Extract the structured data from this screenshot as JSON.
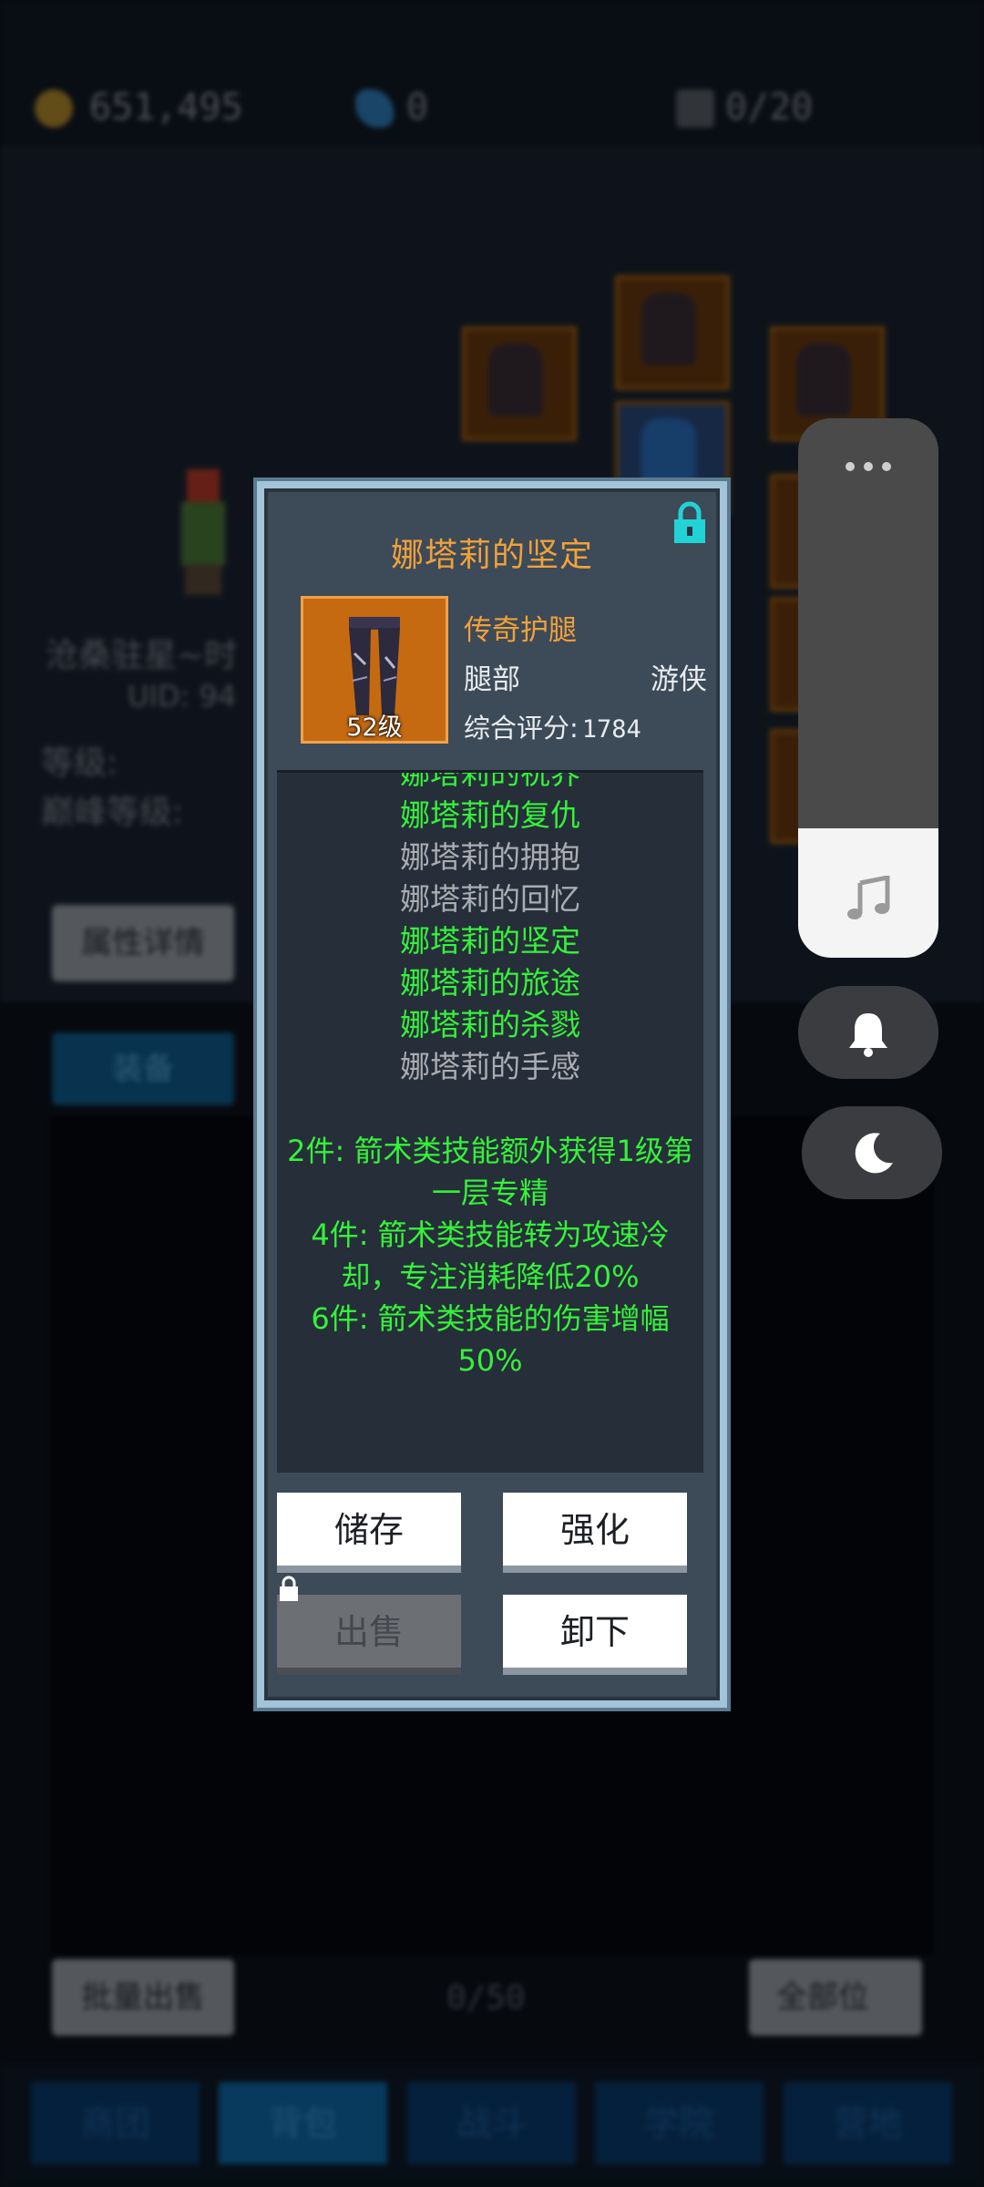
{
  "resources": {
    "gold": "651,495",
    "gems": "0",
    "capacity": "0/20"
  },
  "background": {
    "player_name": "沧桑驻星~时",
    "uid": "UID: 94",
    "level_label": "等级:",
    "peak_level_label": "巅峰等级:",
    "attr_button": "属性详情",
    "equip_tab": "装备",
    "bulk_sell": "批量出售",
    "count": "0/50",
    "all_slots": "全部位"
  },
  "nav": [
    "商团",
    "背包",
    "战斗",
    "学院",
    "营地"
  ],
  "item": {
    "title": "娜塔莉的坚定",
    "rarity": "传奇护腿",
    "slot": "腿部",
    "class": "游侠",
    "score_label": "综合评分:",
    "score": "1784",
    "level": "52级",
    "set_pieces": [
      {
        "name": "娜塔莉的祝界",
        "active": true
      },
      {
        "name": "娜塔莉的复仇",
        "active": true
      },
      {
        "name": "娜塔莉的拥抱",
        "active": false
      },
      {
        "name": "娜塔莉的回忆",
        "active": false
      },
      {
        "name": "娜塔莉的坚定",
        "active": true
      },
      {
        "name": "娜塔莉的旅途",
        "active": true
      },
      {
        "name": "娜塔莉的杀戮",
        "active": true
      },
      {
        "name": "娜塔莉的手感",
        "active": false
      }
    ],
    "bonuses": [
      "2件: 箭术类技能额外获得1级第一层专精",
      "4件: 箭术类技能转为攻速冷却，专注消耗降低20%",
      "6件: 箭术类技能的伤害增幅50%"
    ]
  },
  "buttons": {
    "store": "储存",
    "enhance": "强化",
    "sell": "出售",
    "unequip": "卸下"
  },
  "colors": {
    "legendary": "#f0a13a",
    "set_active": "#35f23a",
    "set_inactive": "#a9adb3",
    "lock": "#22d3d6"
  }
}
